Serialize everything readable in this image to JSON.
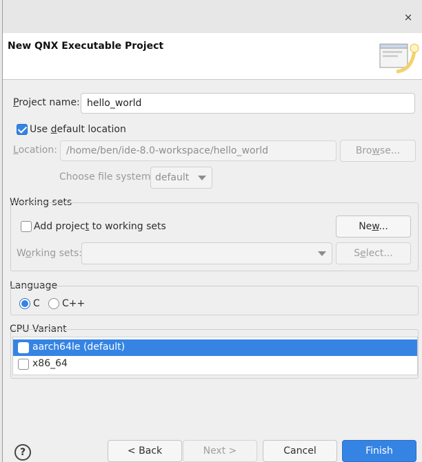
{
  "dialog": {
    "title": "New QNX Executable Project",
    "close_label": "×"
  },
  "project_name": {
    "label_prefix": "P",
    "label_rest": "roject name:",
    "value": "hello_world"
  },
  "use_default_location": {
    "label_prefix": "Use ",
    "label_under": "d",
    "label_rest": "efault location",
    "checked": true
  },
  "location": {
    "label_prefix": "L",
    "label_rest": "ocation:",
    "value": "/home/ben/ide-8.0-workspace/hello_world",
    "browse_label_prefix": "Bro",
    "browse_label_under": "w",
    "browse_label_rest": "se..."
  },
  "file_system": {
    "label": "Choose file system:",
    "value": "default"
  },
  "working_sets": {
    "group_title": "Working sets",
    "add_label_prefix": "Add projec",
    "add_label_under": "t",
    "add_label_rest": " to working sets",
    "new_label_prefix": "Ne",
    "new_label_under": "w",
    "new_label_rest": "...",
    "sets_label_prefix": "W",
    "sets_label_under": "o",
    "sets_label_rest": "rking sets:",
    "select_label_prefix": "S",
    "select_label_under": "e",
    "select_label_rest": "lect..."
  },
  "language": {
    "group_title": "Language",
    "options": [
      "C",
      "C++"
    ],
    "selected": "C"
  },
  "cpu_variant": {
    "group_title": "CPU Variant",
    "items": [
      {
        "label": "aarch64le (default)",
        "checked": true
      },
      {
        "label": "x86_64",
        "checked": false
      }
    ]
  },
  "footer": {
    "help_label": "?",
    "back_label": "< Back",
    "next_label": "Next >",
    "cancel_label": "Cancel",
    "finish_label": "Finish"
  },
  "colors": {
    "accent": "#3584e4",
    "dialog_bg": "#efefef"
  }
}
